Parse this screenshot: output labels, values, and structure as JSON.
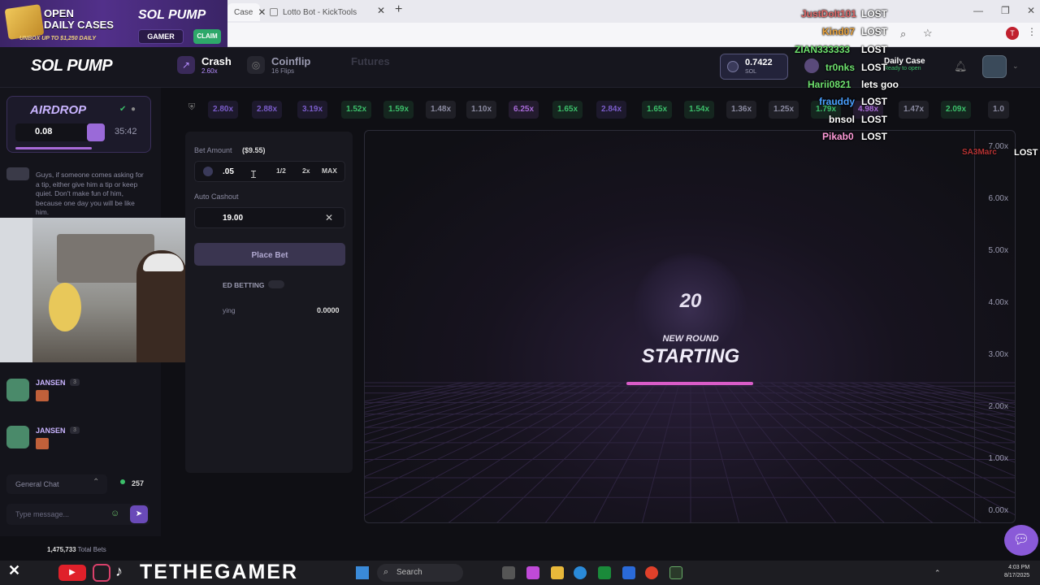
{
  "browser": {
    "tab_active_partial": "Case",
    "tab2_title": "Lotto Bot - KickTools"
  },
  "promo": {
    "line1": "OPEN",
    "line2": "DAILY CASES",
    "sub": "UNBOX UP TO $1,250 DAILY",
    "logo": "SOL PUMP",
    "gamer": "GAMER",
    "claim": "CLAIM"
  },
  "header": {
    "logo": "SOL PUMP",
    "nav": [
      {
        "title": "Crash",
        "sub": "2.60x"
      },
      {
        "title": "Coinflip",
        "sub": "16 Flips"
      },
      {
        "title": "Futures",
        "sub": ""
      }
    ],
    "balance_value": "0.7422",
    "balance_unit": "SOL",
    "daily_case_title": "Daily Case",
    "daily_case_sub": "Ready to open"
  },
  "overlay_chat": [
    {
      "user": "JustDoIt101",
      "msg": "LOST",
      "color": "#e06a6a"
    },
    {
      "user": "Kind07",
      "msg": "LOST",
      "color": "#e8a23c"
    },
    {
      "user": "ZIAN333333",
      "msg": "LOST",
      "color": "#6ee06e"
    },
    {
      "user": "tr0nks",
      "msg": "LOST",
      "color": "#6ee06e"
    },
    {
      "user": "Harii0821",
      "msg": "lets goo",
      "color": "#6ee06e"
    },
    {
      "user": "frauddy",
      "msg": "LOST",
      "color": "#4aa0ff"
    },
    {
      "user": "bnsol",
      "msg": "LOST",
      "color": "#ffffff"
    },
    {
      "user": "Pikab0",
      "msg": "LOST",
      "color": "#ff9ad8"
    },
    {
      "user": "SA3Marc",
      "msg": "LOST",
      "color": "#e03c3c"
    }
  ],
  "airdrop": {
    "title": "AIRDROP",
    "amount": "0.08",
    "timer": "35:42"
  },
  "chat": {
    "message": "Guys, if someone comes asking for a tip, either give him a tip or keep quiet. Don't make fun of him, because one day you will be like him.",
    "users": [
      {
        "name": "JANSEN",
        "level": "3"
      },
      {
        "name": "JANSEN",
        "level": "3"
      }
    ],
    "channel": "General Chat",
    "online": "257",
    "input_placeholder": "Type message...",
    "total_bets": "1,475,733",
    "total_bets_label": "Total Bets"
  },
  "multipliers": [
    {
      "v": "2.80x",
      "c": "#7a5cc9"
    },
    {
      "v": "2.88x",
      "c": "#7a5cc9"
    },
    {
      "v": "3.19x",
      "c": "#7a5cc9"
    },
    {
      "v": "1.52x",
      "c": "#3cbf6a"
    },
    {
      "v": "1.59x",
      "c": "#3cbf6a"
    },
    {
      "v": "1.48x",
      "c": "#8a8aa0"
    },
    {
      "v": "1.10x",
      "c": "#8a8aa0"
    },
    {
      "v": "6.25x",
      "c": "#a86ad8"
    },
    {
      "v": "1.65x",
      "c": "#3cbf6a"
    },
    {
      "v": "2.84x",
      "c": "#7a5cc9"
    },
    {
      "v": "1.65x",
      "c": "#3cbf6a"
    },
    {
      "v": "1.54x",
      "c": "#3cbf6a"
    },
    {
      "v": "1.36x",
      "c": "#8a8aa0"
    },
    {
      "v": "1.25x",
      "c": "#8a8aa0"
    },
    {
      "v": "1.79x",
      "c": "#3cbf6a"
    },
    {
      "v": "4.98x",
      "c": "#a86ad8"
    },
    {
      "v": "1.47x",
      "c": "#8a8aa0"
    },
    {
      "v": "2.09x",
      "c": "#3cbf6a"
    },
    {
      "v": "1.0",
      "c": "#8a8aa0"
    }
  ],
  "bet": {
    "amount_label": "Bet Amount",
    "amount_usd": "($9.55)",
    "amount_value": ".05",
    "half": "1/2",
    "double": "2x",
    "max": "MAX",
    "autocashout_label": "Auto Cashout",
    "autocashout_value": "19.00",
    "place_bet": "Place Bet",
    "advanced_betting": "ED BETTING",
    "playing_label": "ying",
    "playing_value": "0.0000"
  },
  "game": {
    "countdown": "20",
    "round_label": "NEW ROUND",
    "status": "STARTING",
    "countdown_progress": 0.5,
    "y_ticks": [
      "7.00x",
      "6.00x",
      "5.00x",
      "4.00x",
      "3.00x",
      "2.00x",
      "1.00x",
      "0.00x"
    ]
  },
  "overlay_brand": {
    "name": "TETHEGAMER"
  },
  "taskbar": {
    "search": "Search",
    "time": "4:03 PM",
    "date": "8/17/2025"
  },
  "icons": [
    "close-icon",
    "plus-icon",
    "search-icon",
    "star-icon",
    "bell-icon",
    "send-icon",
    "chat-bubble-icon",
    "x-logo-icon",
    "youtube-icon",
    "instagram-icon",
    "tiktok-icon",
    "windows-icon"
  ]
}
